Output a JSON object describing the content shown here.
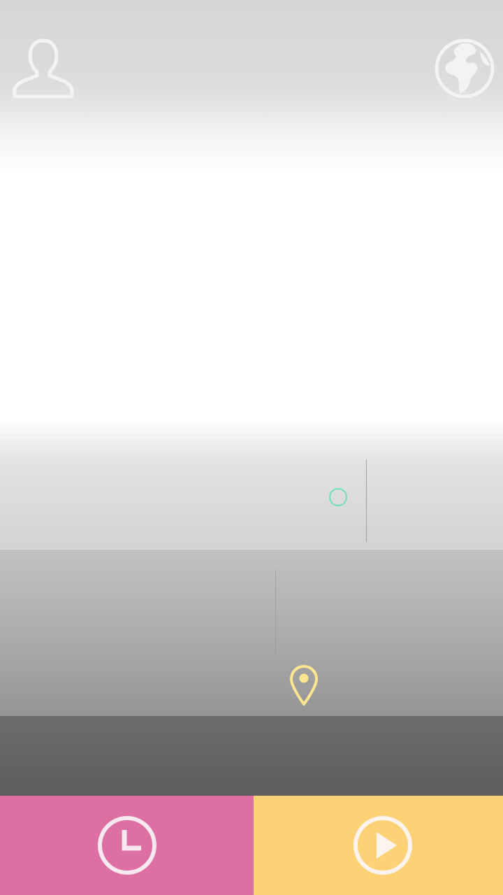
{
  "top_bar": {
    "profile_icon": "user-outline-icon",
    "globe_icon": "globe-icon"
  },
  "map": {
    "location_marker_icon": "map-pin-icon",
    "target_circle_icon": "circle-outline-icon",
    "colors": {
      "target_circle": "#6fe0c1",
      "pin": "#fde68f"
    }
  },
  "bottom_bar": {
    "left_button": {
      "icon": "clock-icon",
      "color": "#dd6fa2"
    },
    "right_button": {
      "icon": "play-icon",
      "color": "#fdd277"
    }
  }
}
